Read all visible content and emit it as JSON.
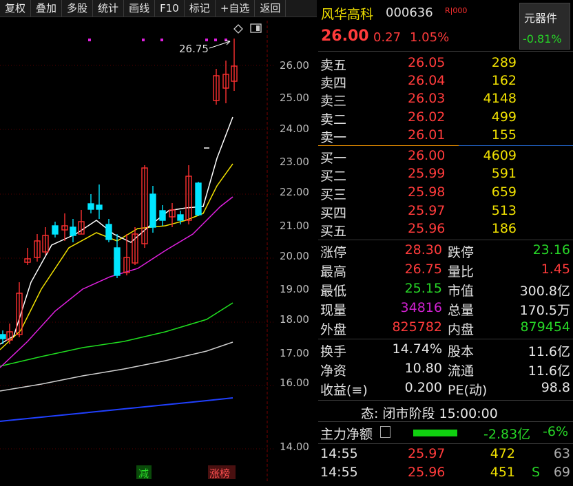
{
  "toolbar": [
    "复权",
    "叠加",
    "多股",
    "统计",
    "画线",
    "F10",
    "标记",
    "+自选",
    "返回"
  ],
  "chart": {
    "price_labels": [
      "26.00",
      "25.00",
      "24.00",
      "23.00",
      "22.00",
      "21.00",
      "20.00",
      "19.00",
      "18.00",
      "17.00",
      "16.00",
      "14.00"
    ],
    "high_annotation": "26.75",
    "bottom_tags": {
      "reduce": "减",
      "limit": "涨榜"
    },
    "colors": {
      "up": "#ff3030",
      "down": "#00e5ff",
      "ma5": "#ffffff",
      "ma10": "#f0e000",
      "ma20": "#e020e0",
      "ma60": "#20e020",
      "ma120": "#d0d0d0",
      "ma250": "#2040ff"
    },
    "icons": [
      "diamond-icon",
      "panel-toggle-icon"
    ]
  },
  "header": {
    "name": "风华高科",
    "code": "000636",
    "tag": "R|000",
    "price": "26.00",
    "change": "0.27",
    "percent": "1.05%"
  },
  "sector": {
    "name": "元器件",
    "percent": "-0.81%"
  },
  "asks": [
    {
      "label": "卖五",
      "price": "26.05",
      "vol": "289"
    },
    {
      "label": "卖四",
      "price": "26.04",
      "vol": "162"
    },
    {
      "label": "卖三",
      "price": "26.03",
      "vol": "4148"
    },
    {
      "label": "卖二",
      "price": "26.02",
      "vol": "499"
    },
    {
      "label": "卖一",
      "price": "26.01",
      "vol": "155"
    }
  ],
  "bids": [
    {
      "label": "买一",
      "price": "26.00",
      "vol": "4609"
    },
    {
      "label": "买二",
      "price": "25.99",
      "vol": "591"
    },
    {
      "label": "买三",
      "price": "25.98",
      "vol": "659"
    },
    {
      "label": "买四",
      "price": "25.97",
      "vol": "513"
    },
    {
      "label": "买五",
      "price": "25.96",
      "vol": "186"
    }
  ],
  "stats": [
    {
      "k1": "涨停",
      "v1": "28.30",
      "c1": "red",
      "k2": "跌停",
      "v2": "23.16",
      "c2": "grn"
    },
    {
      "k1": "最高",
      "v1": "26.75",
      "c1": "red",
      "k2": "量比",
      "v2": "1.45",
      "c2": "red"
    },
    {
      "k1": "最低",
      "v1": "25.15",
      "c1": "grn",
      "k2": "市值",
      "v2": "300.8亿",
      "c2": "wht"
    },
    {
      "k1": "现量",
      "v1": "34816",
      "c1": "mag",
      "k2": "总量",
      "v2": "170.5万",
      "c2": "wht"
    },
    {
      "k1": "外盘",
      "v1": "825782",
      "c1": "red",
      "k2": "内盘",
      "v2": "879454",
      "c2": "grn"
    }
  ],
  "stats2": [
    {
      "k1": "换手",
      "v1": "14.74%",
      "k2": "股本",
      "v2": "11.6亿"
    },
    {
      "k1": "净资",
      "v1": "10.80",
      "k2": "流通",
      "v2": "11.6亿"
    },
    {
      "k1": "收益(≡)",
      "v1": "0.200",
      "k2": "PE(动)",
      "v2": "98.8"
    }
  ],
  "status": "态: 闭市阶段 15:00:00",
  "flow": {
    "label": "主力净额",
    "value": "-2.83亿",
    "percent": "-6%"
  },
  "ticks": [
    {
      "time": "14:55",
      "price": "25.97",
      "vol": "472",
      "flag": "",
      "n": "63"
    },
    {
      "time": "14:55",
      "price": "25.96",
      "vol": "451",
      "flag": "S",
      "n": "69"
    }
  ]
}
